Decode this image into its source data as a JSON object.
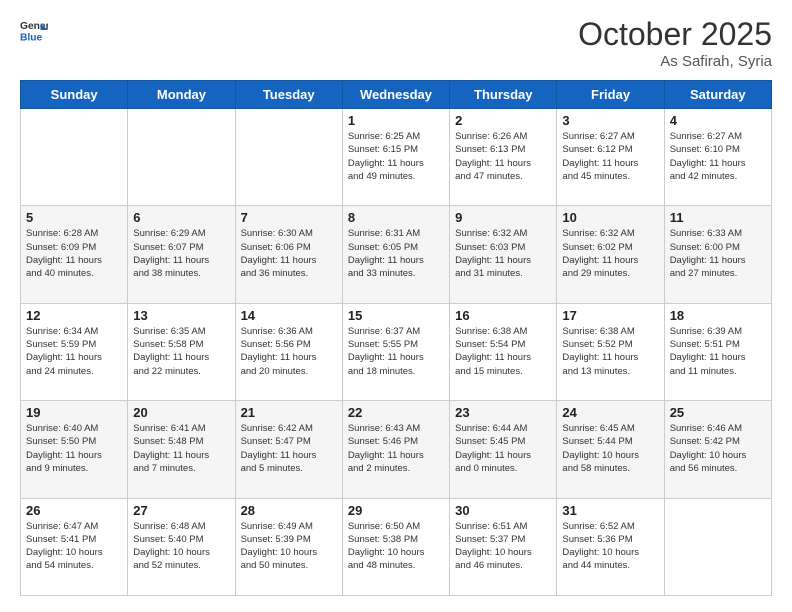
{
  "header": {
    "logo": {
      "line1": "General",
      "line2": "Blue"
    },
    "month": "October 2025",
    "location": "As Safirah, Syria"
  },
  "weekdays": [
    "Sunday",
    "Monday",
    "Tuesday",
    "Wednesday",
    "Thursday",
    "Friday",
    "Saturday"
  ],
  "weeks": [
    [
      {
        "day": "",
        "info": ""
      },
      {
        "day": "",
        "info": ""
      },
      {
        "day": "",
        "info": ""
      },
      {
        "day": "1",
        "info": "Sunrise: 6:25 AM\nSunset: 6:15 PM\nDaylight: 11 hours\nand 49 minutes."
      },
      {
        "day": "2",
        "info": "Sunrise: 6:26 AM\nSunset: 6:13 PM\nDaylight: 11 hours\nand 47 minutes."
      },
      {
        "day": "3",
        "info": "Sunrise: 6:27 AM\nSunset: 6:12 PM\nDaylight: 11 hours\nand 45 minutes."
      },
      {
        "day": "4",
        "info": "Sunrise: 6:27 AM\nSunset: 6:10 PM\nDaylight: 11 hours\nand 42 minutes."
      }
    ],
    [
      {
        "day": "5",
        "info": "Sunrise: 6:28 AM\nSunset: 6:09 PM\nDaylight: 11 hours\nand 40 minutes."
      },
      {
        "day": "6",
        "info": "Sunrise: 6:29 AM\nSunset: 6:07 PM\nDaylight: 11 hours\nand 38 minutes."
      },
      {
        "day": "7",
        "info": "Sunrise: 6:30 AM\nSunset: 6:06 PM\nDaylight: 11 hours\nand 36 minutes."
      },
      {
        "day": "8",
        "info": "Sunrise: 6:31 AM\nSunset: 6:05 PM\nDaylight: 11 hours\nand 33 minutes."
      },
      {
        "day": "9",
        "info": "Sunrise: 6:32 AM\nSunset: 6:03 PM\nDaylight: 11 hours\nand 31 minutes."
      },
      {
        "day": "10",
        "info": "Sunrise: 6:32 AM\nSunset: 6:02 PM\nDaylight: 11 hours\nand 29 minutes."
      },
      {
        "day": "11",
        "info": "Sunrise: 6:33 AM\nSunset: 6:00 PM\nDaylight: 11 hours\nand 27 minutes."
      }
    ],
    [
      {
        "day": "12",
        "info": "Sunrise: 6:34 AM\nSunset: 5:59 PM\nDaylight: 11 hours\nand 24 minutes."
      },
      {
        "day": "13",
        "info": "Sunrise: 6:35 AM\nSunset: 5:58 PM\nDaylight: 11 hours\nand 22 minutes."
      },
      {
        "day": "14",
        "info": "Sunrise: 6:36 AM\nSunset: 5:56 PM\nDaylight: 11 hours\nand 20 minutes."
      },
      {
        "day": "15",
        "info": "Sunrise: 6:37 AM\nSunset: 5:55 PM\nDaylight: 11 hours\nand 18 minutes."
      },
      {
        "day": "16",
        "info": "Sunrise: 6:38 AM\nSunset: 5:54 PM\nDaylight: 11 hours\nand 15 minutes."
      },
      {
        "day": "17",
        "info": "Sunrise: 6:38 AM\nSunset: 5:52 PM\nDaylight: 11 hours\nand 13 minutes."
      },
      {
        "day": "18",
        "info": "Sunrise: 6:39 AM\nSunset: 5:51 PM\nDaylight: 11 hours\nand 11 minutes."
      }
    ],
    [
      {
        "day": "19",
        "info": "Sunrise: 6:40 AM\nSunset: 5:50 PM\nDaylight: 11 hours\nand 9 minutes."
      },
      {
        "day": "20",
        "info": "Sunrise: 6:41 AM\nSunset: 5:48 PM\nDaylight: 11 hours\nand 7 minutes."
      },
      {
        "day": "21",
        "info": "Sunrise: 6:42 AM\nSunset: 5:47 PM\nDaylight: 11 hours\nand 5 minutes."
      },
      {
        "day": "22",
        "info": "Sunrise: 6:43 AM\nSunset: 5:46 PM\nDaylight: 11 hours\nand 2 minutes."
      },
      {
        "day": "23",
        "info": "Sunrise: 6:44 AM\nSunset: 5:45 PM\nDaylight: 11 hours\nand 0 minutes."
      },
      {
        "day": "24",
        "info": "Sunrise: 6:45 AM\nSunset: 5:44 PM\nDaylight: 10 hours\nand 58 minutes."
      },
      {
        "day": "25",
        "info": "Sunrise: 6:46 AM\nSunset: 5:42 PM\nDaylight: 10 hours\nand 56 minutes."
      }
    ],
    [
      {
        "day": "26",
        "info": "Sunrise: 6:47 AM\nSunset: 5:41 PM\nDaylight: 10 hours\nand 54 minutes."
      },
      {
        "day": "27",
        "info": "Sunrise: 6:48 AM\nSunset: 5:40 PM\nDaylight: 10 hours\nand 52 minutes."
      },
      {
        "day": "28",
        "info": "Sunrise: 6:49 AM\nSunset: 5:39 PM\nDaylight: 10 hours\nand 50 minutes."
      },
      {
        "day": "29",
        "info": "Sunrise: 6:50 AM\nSunset: 5:38 PM\nDaylight: 10 hours\nand 48 minutes."
      },
      {
        "day": "30",
        "info": "Sunrise: 6:51 AM\nSunset: 5:37 PM\nDaylight: 10 hours\nand 46 minutes."
      },
      {
        "day": "31",
        "info": "Sunrise: 6:52 AM\nSunset: 5:36 PM\nDaylight: 10 hours\nand 44 minutes."
      },
      {
        "day": "",
        "info": ""
      }
    ]
  ]
}
